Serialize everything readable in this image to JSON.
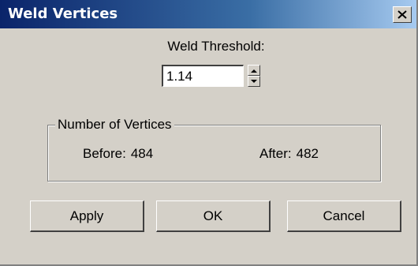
{
  "window": {
    "title": "Weld Vertices",
    "close_icon": "close-icon"
  },
  "threshold": {
    "label": "Weld Threshold:",
    "value": "1.14"
  },
  "vertices": {
    "group_label": "Number of Vertices",
    "before_label": "Before:",
    "before_value": "484",
    "after_label": "After:",
    "after_value": "482"
  },
  "buttons": {
    "apply": "Apply",
    "ok": "OK",
    "cancel": "Cancel"
  },
  "colors": {
    "title_bar_start": "#0a246a",
    "title_bar_end": "#a6caf0",
    "face": "#d4d0c8"
  }
}
